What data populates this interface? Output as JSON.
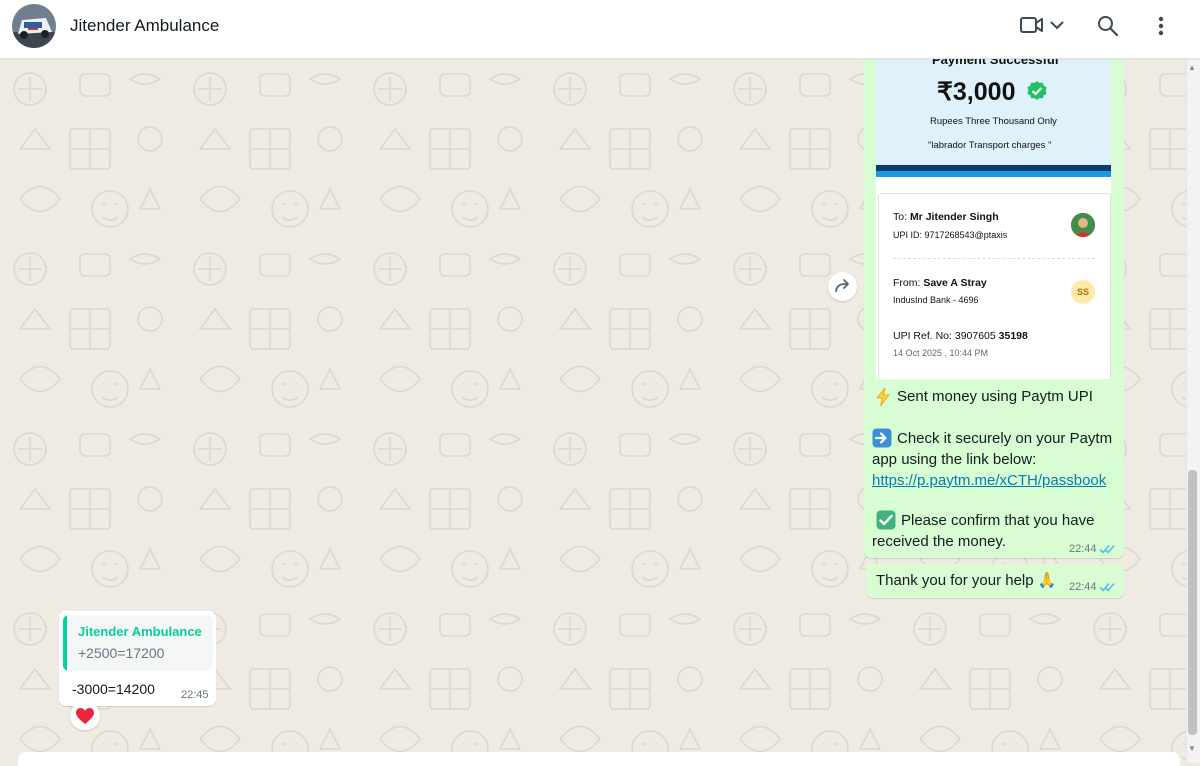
{
  "header": {
    "contact_name": "Jitender Ambulance",
    "icons": [
      "video-call-icon",
      "chevron-down-icon",
      "search-icon",
      "menu-icon"
    ]
  },
  "receipt": {
    "status": "Payment Successful",
    "amount": "₹3,000",
    "amount_words": "Rupees Three Thousand Only",
    "note": "\"labrador Transport charges \"",
    "to_label": "To:",
    "to_name": "Mr Jitender Singh",
    "to_upi": "UPI ID: 9717268543@ptaxis",
    "from_label": "From:",
    "from_name": "Save A Stray",
    "from_bank": "IndusInd Bank - 4696",
    "from_initials": "SS",
    "ref_label": "UPI Ref. No: 3907605",
    "ref_bold": "35198",
    "datetime": "14 Oct 2025 , 10:44 PM"
  },
  "paytm_message": {
    "line1": "Sent money using Paytm UPI",
    "line2": "Check it securely on your Paytm",
    "line3": "app using the link below:",
    "link": "https://p.paytm.me/xCTH/passbook",
    "line4": "Please confirm that you have",
    "line5": "received the money.",
    "time": "22:44"
  },
  "thanks_message": {
    "text": "Thank you for your help",
    "emoji": "🙏",
    "time": "22:44"
  },
  "reply_message": {
    "quoted_author": "Jitender Ambulance",
    "quoted_text": "+2500=17200",
    "text": "-3000=14200",
    "time": "22:45",
    "reaction": "❤️"
  },
  "colors": {
    "outgoing_bubble": "#d9fdd3",
    "chat_background": "#efeae2",
    "quote_accent": "#06cf9c",
    "ticks_read": "#53bdeb",
    "link": "#027eb5"
  }
}
